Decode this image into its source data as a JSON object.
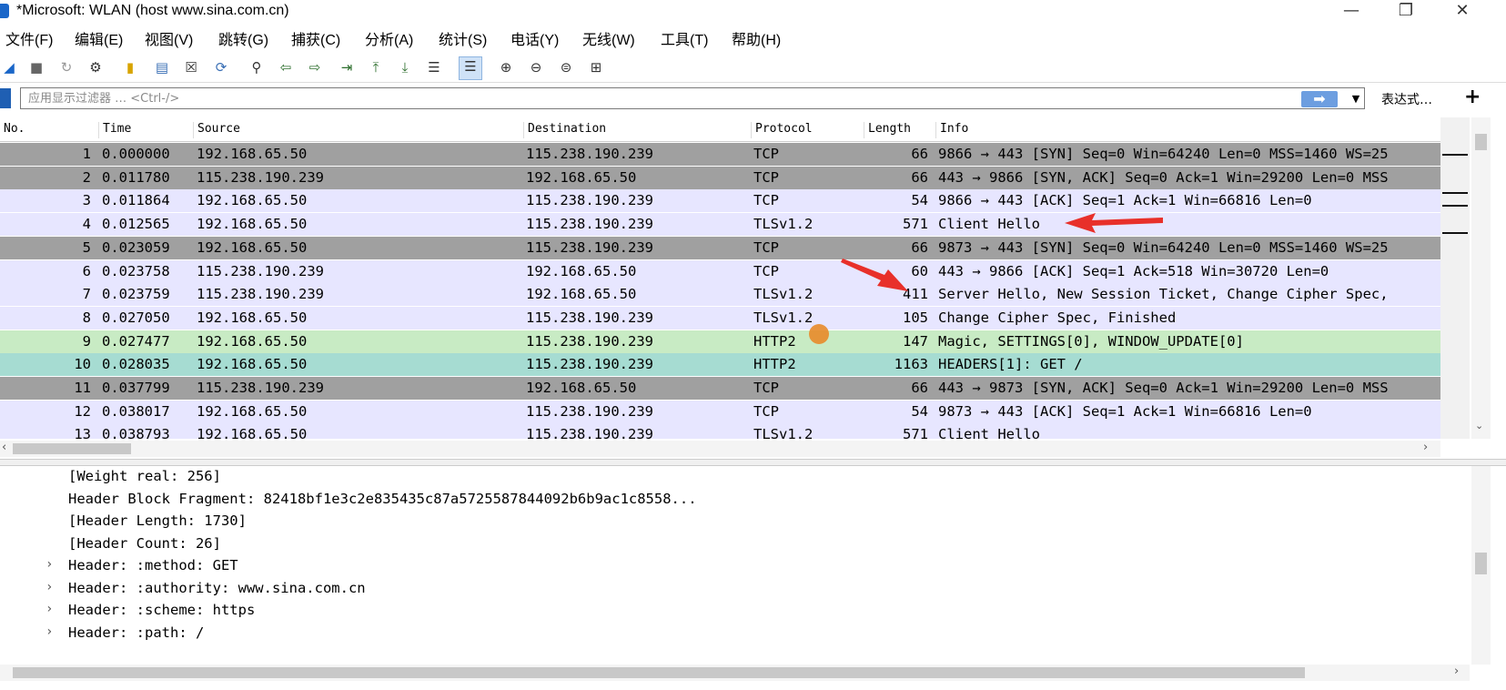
{
  "window": {
    "title": "*Microsoft: WLAN (host www.sina.com.cn)",
    "minimize_glyph": "—",
    "restore_glyph": "❐",
    "close_glyph": "✕"
  },
  "menu": {
    "items": [
      "文件(F)",
      "编辑(E)",
      "视图(V)",
      "跳转(G)",
      "捕获(C)",
      "分析(A)",
      "统计(S)",
      "电话(Y)",
      "无线(W)",
      "工具(T)",
      "帮助(H)"
    ]
  },
  "toolbar": {
    "icons": [
      "shark-fin-start-icon",
      "stop-icon",
      "restart-icon",
      "options-gear-icon",
      "open-file-icon",
      "save-file-icon",
      "close-file-icon",
      "reload-icon",
      "find-icon",
      "go-back-icon",
      "go-forward-icon",
      "go-to-packet-icon",
      "first-packet-icon",
      "last-packet-icon",
      "autoscroll-icon",
      "colorize-icon",
      "zoom-in-icon",
      "zoom-out-icon",
      "zoom-reset-icon",
      "resize-columns-icon"
    ]
  },
  "filter": {
    "placeholder": "应用显示过滤器 … <Ctrl-/>",
    "expression_label": "表达式…",
    "add_label": "+"
  },
  "packet_list": {
    "columns": [
      "No.",
      "Time",
      "Source",
      "Destination",
      "Protocol",
      "Length",
      "Info"
    ],
    "rows": [
      {
        "no": "1",
        "time": "0.000000",
        "src": "192.168.65.50",
        "dst": "115.238.190.239",
        "proto": "TCP",
        "len": "66",
        "info": "9866 → 443 [SYN] Seq=0 Win=64240 Len=0 MSS=1460 WS=25",
        "bg": "#a0a0a0"
      },
      {
        "no": "2",
        "time": "0.011780",
        "src": "115.238.190.239",
        "dst": "192.168.65.50",
        "proto": "TCP",
        "len": "66",
        "info": "443 → 9866 [SYN, ACK] Seq=0 Ack=1 Win=29200 Len=0 MSS",
        "bg": "#a0a0a0"
      },
      {
        "no": "3",
        "time": "0.011864",
        "src": "192.168.65.50",
        "dst": "115.238.190.239",
        "proto": "TCP",
        "len": "54",
        "info": "9866 → 443 [ACK] Seq=1 Ack=1 Win=66816 Len=0",
        "bg": "#e7e6ff"
      },
      {
        "no": "4",
        "time": "0.012565",
        "src": "192.168.65.50",
        "dst": "115.238.190.239",
        "proto": "TLSv1.2",
        "len": "571",
        "info": "Client Hello",
        "bg": "#e7e6ff"
      },
      {
        "no": "5",
        "time": "0.023059",
        "src": "192.168.65.50",
        "dst": "115.238.190.239",
        "proto": "TCP",
        "len": "66",
        "info": "9873 → 443 [SYN] Seq=0 Win=64240 Len=0 MSS=1460 WS=25",
        "bg": "#a0a0a0"
      },
      {
        "no": "6",
        "time": "0.023758",
        "src": "115.238.190.239",
        "dst": "192.168.65.50",
        "proto": "TCP",
        "len": "60",
        "info": "443 → 9866 [ACK] Seq=1 Ack=518 Win=30720 Len=0",
        "bg": "#e7e6ff"
      },
      {
        "no": "7",
        "time": "0.023759",
        "src": "115.238.190.239",
        "dst": "192.168.65.50",
        "proto": "TLSv1.2",
        "len": "411",
        "info": "Server Hello, New Session Ticket, Change Cipher Spec,",
        "bg": "#e7e6ff"
      },
      {
        "no": "8",
        "time": "0.027050",
        "src": "192.168.65.50",
        "dst": "115.238.190.239",
        "proto": "TLSv1.2",
        "len": "105",
        "info": "Change Cipher Spec, Finished",
        "bg": "#e7e6ff"
      },
      {
        "no": "9",
        "time": "0.027477",
        "src": "192.168.65.50",
        "dst": "115.238.190.239",
        "proto": "HTTP2",
        "len": "147",
        "info": "Magic, SETTINGS[0], WINDOW_UPDATE[0]",
        "bg": "#c8ebc4"
      },
      {
        "no": "10",
        "time": "0.028035",
        "src": "192.168.65.50",
        "dst": "115.238.190.239",
        "proto": "HTTP2",
        "len": "1163",
        "info": "HEADERS[1]: GET /",
        "bg": "#a6dcd2"
      },
      {
        "no": "11",
        "time": "0.037799",
        "src": "115.238.190.239",
        "dst": "192.168.65.50",
        "proto": "TCP",
        "len": "66",
        "info": "443 → 9873 [SYN, ACK] Seq=0 Ack=1 Win=29200 Len=0 MSS",
        "bg": "#a0a0a0"
      },
      {
        "no": "12",
        "time": "0.038017",
        "src": "192.168.65.50",
        "dst": "115.238.190.239",
        "proto": "TCP",
        "len": "54",
        "info": "9873 → 443 [ACK] Seq=1 Ack=1 Win=66816 Len=0",
        "bg": "#e7e6ff"
      },
      {
        "no": "13",
        "time": "0.038793",
        "src": "192.168.65.50",
        "dst": "115.238.190.239",
        "proto": "TLSv1.2",
        "len": "571",
        "info": "Client Hello",
        "bg": "#e7e6ff"
      }
    ]
  },
  "details": {
    "lines": [
      {
        "text": "[Weight real: 256]",
        "expandable": false
      },
      {
        "text": "Header Block Fragment: 82418bf1e3c2e835435c87a5725587844092b6b9ac1c8558...",
        "expandable": false
      },
      {
        "text": "[Header Length: 1730]",
        "expandable": false
      },
      {
        "text": "[Header Count: 26]",
        "expandable": false
      },
      {
        "text": "Header: :method: GET",
        "expandable": true
      },
      {
        "text": "Header: :authority: www.sina.com.cn",
        "expandable": true
      },
      {
        "text": "Header: :scheme: https",
        "expandable": true
      },
      {
        "text": "Header: :path: /",
        "expandable": true
      }
    ]
  },
  "colors": {
    "tcp_syn": "#a0a0a0",
    "tcp": "#e7e6ff",
    "http2_magic": "#c8ebc4",
    "http2_headers": "#a6dcd2",
    "annotation_arrow": "#e8302a",
    "cursor_highlight": "#e88b2a"
  }
}
